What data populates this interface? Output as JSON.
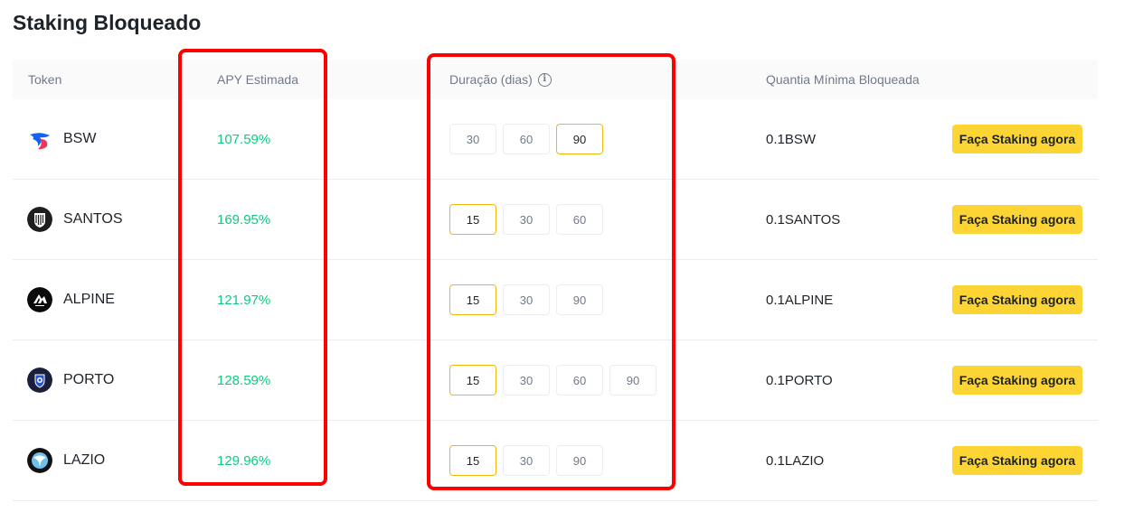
{
  "page": {
    "title": "Staking Bloqueado"
  },
  "table": {
    "headers": {
      "token": "Token",
      "apy": "APY Estimada",
      "duration": "Duração (dias)",
      "min_amount": "Quantia Mínima Bloqueada"
    },
    "info_icon": "info-icon",
    "rows": [
      {
        "token": "BSW",
        "icon": "bsw-logo-icon",
        "apy": "107.59%",
        "durations": [
          "30",
          "60",
          "90"
        ],
        "selected": "90",
        "min": "0.1BSW",
        "button": "Faça Staking agora"
      },
      {
        "token": "SANTOS",
        "icon": "santos-logo-icon",
        "apy": "169.95%",
        "durations": [
          "15",
          "30",
          "60"
        ],
        "selected": "15",
        "min": "0.1SANTOS",
        "button": "Faça Staking agora"
      },
      {
        "token": "ALPINE",
        "icon": "alpine-logo-icon",
        "apy": "121.97%",
        "durations": [
          "15",
          "30",
          "90"
        ],
        "selected": "15",
        "min": "0.1ALPINE",
        "button": "Faça Staking agora"
      },
      {
        "token": "PORTO",
        "icon": "porto-logo-icon",
        "apy": "128.59%",
        "durations": [
          "15",
          "30",
          "60",
          "90"
        ],
        "selected": "15",
        "min": "0.1PORTO",
        "button": "Faça Staking agora"
      },
      {
        "token": "LAZIO",
        "icon": "lazio-logo-icon",
        "apy": "129.96%",
        "durations": [
          "15",
          "30",
          "90"
        ],
        "selected": "15",
        "min": "0.1LAZIO",
        "button": "Faça Staking agora"
      }
    ]
  },
  "colors": {
    "apy_green": "#0ecb81",
    "button_yellow": "#fcd535",
    "selected_border": "#f0b90b",
    "highlight_red": "#ff0000"
  }
}
